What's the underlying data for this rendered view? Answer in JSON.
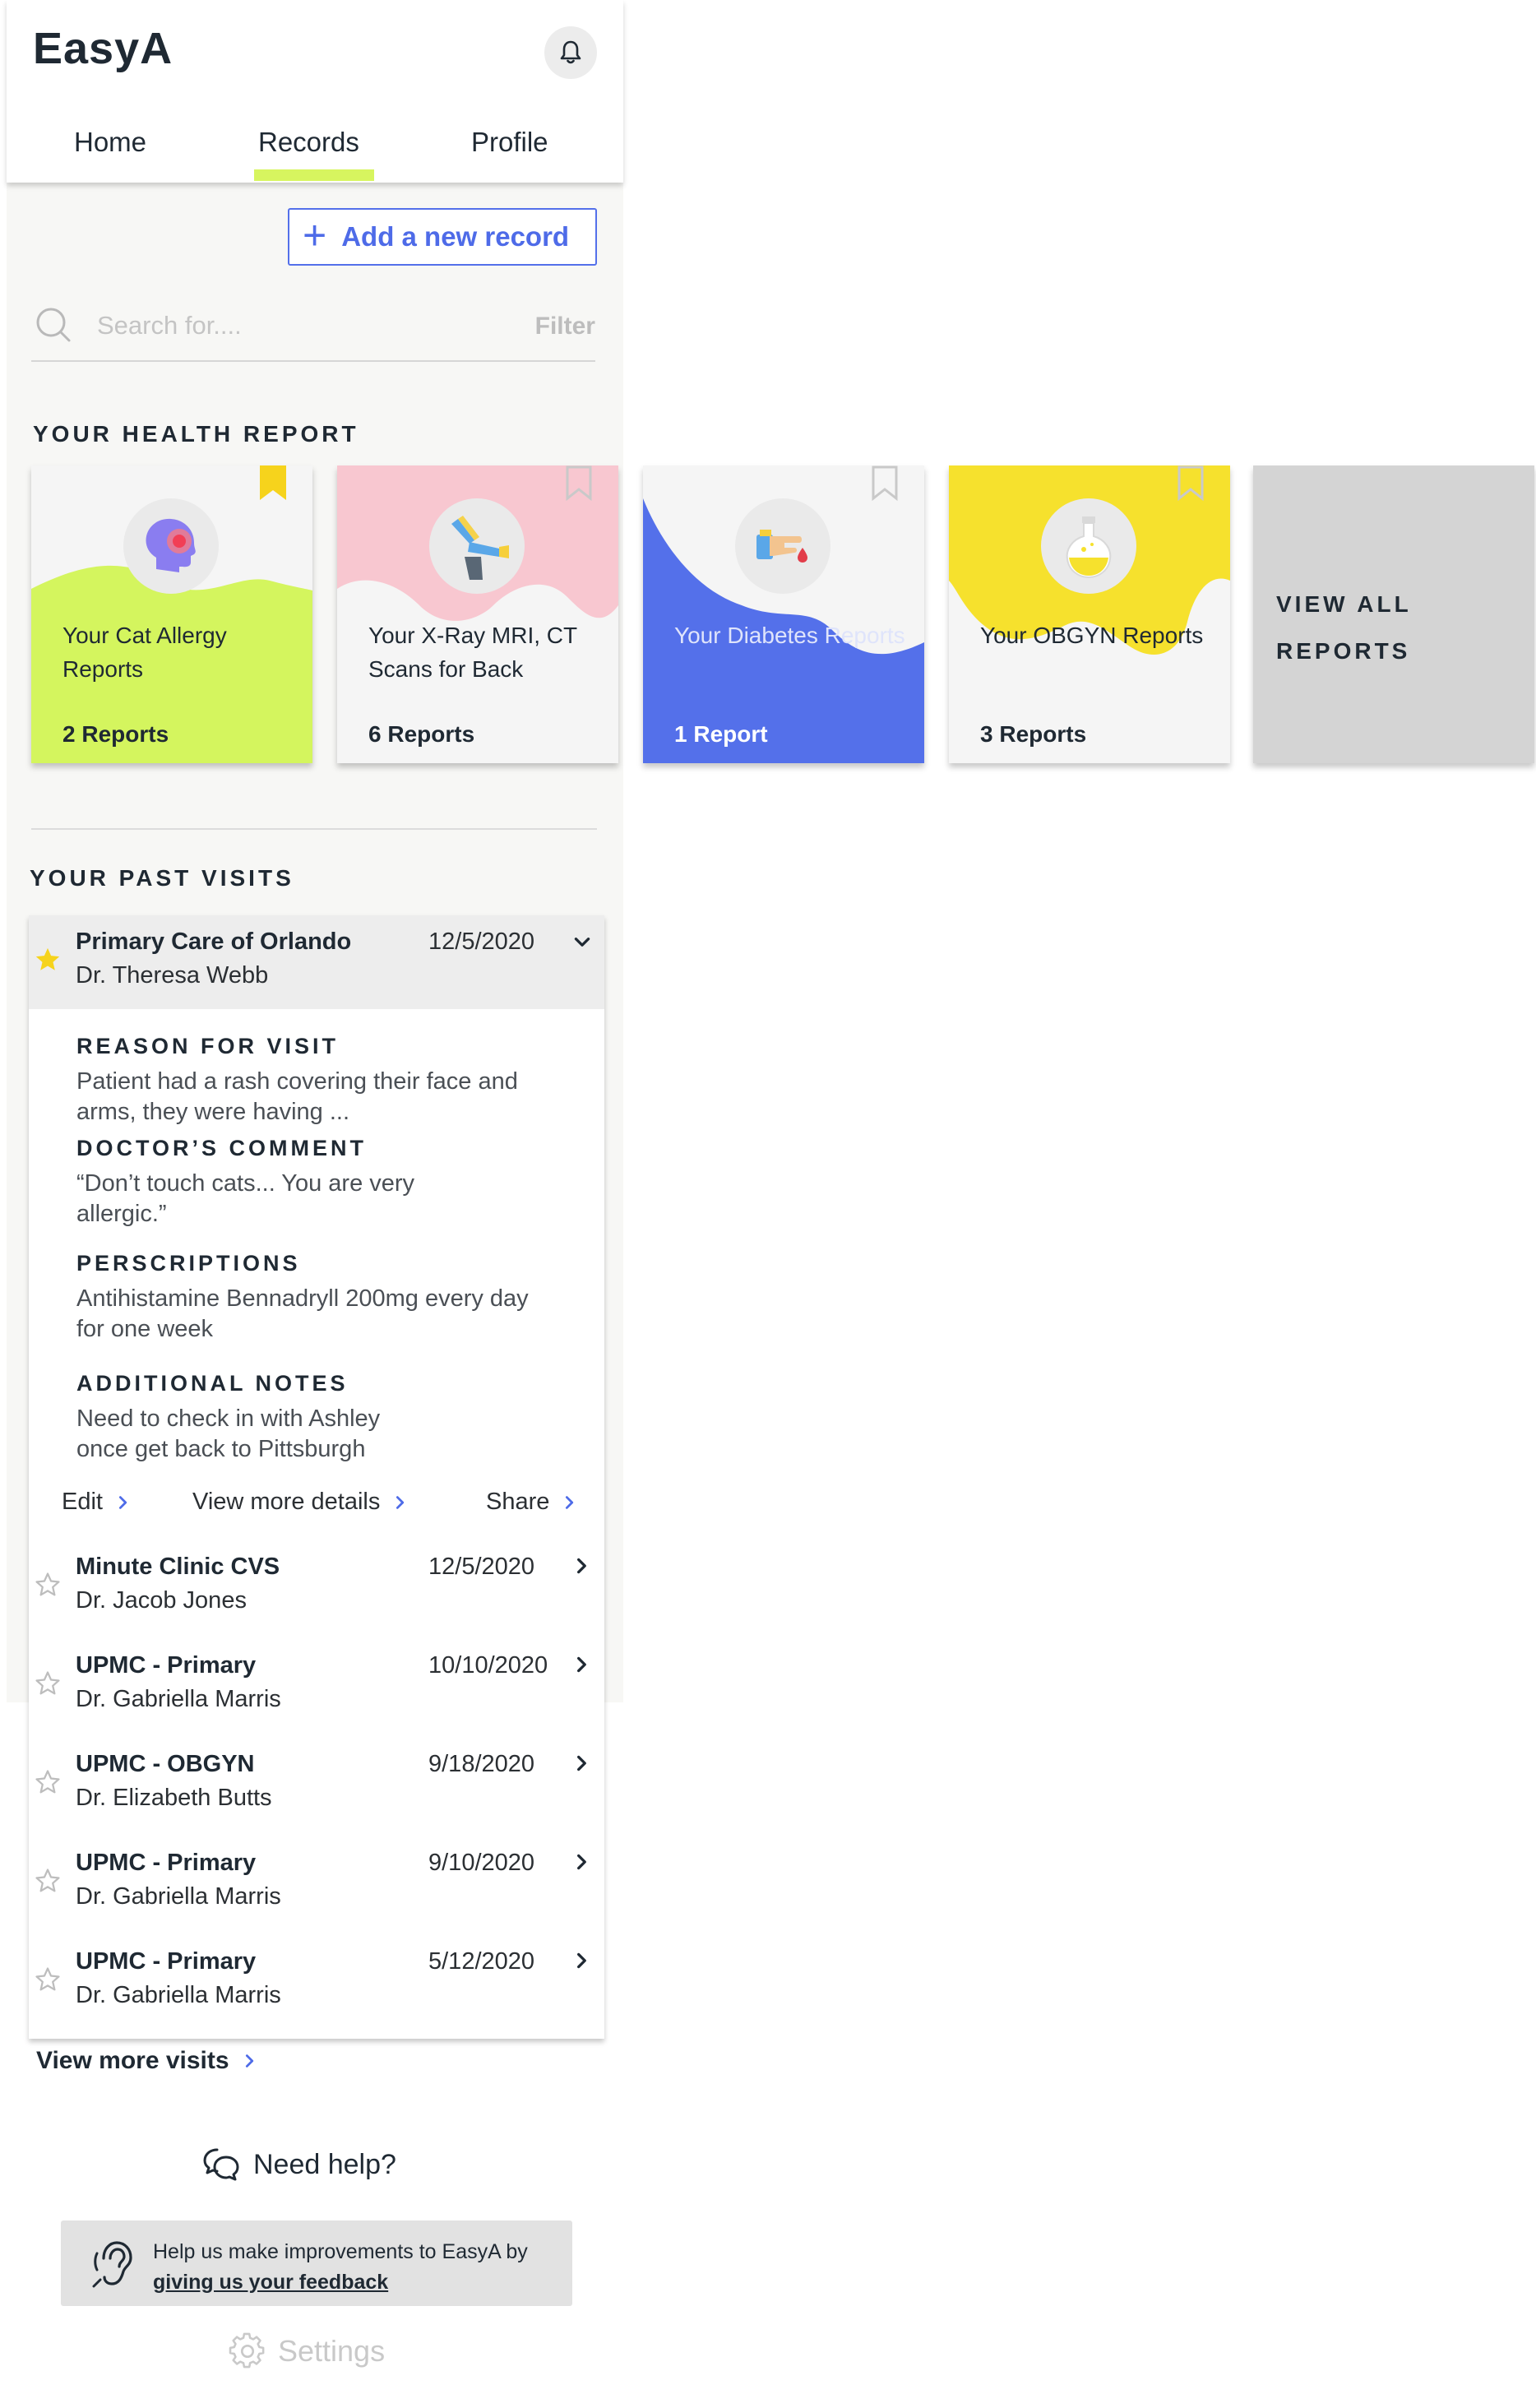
{
  "app": {
    "name": "EasyA"
  },
  "tabs": [
    {
      "label": "Home"
    },
    {
      "label": "Records",
      "active": true
    },
    {
      "label": "Profile"
    }
  ],
  "add_record": {
    "label": "Add a new record"
  },
  "search": {
    "placeholder": "Search for....",
    "filter_label": "Filter"
  },
  "health_report": {
    "title": "YOUR HEALTH REPORT",
    "cards": [
      {
        "title": "Your Cat Allergy Reports",
        "count": "2 Reports",
        "color": "#d4f55e",
        "bookmarked": true,
        "icon": "allergy-head-icon"
      },
      {
        "title": "Your X-Ray MRI, CT Scans for Back",
        "count": "6 Reports",
        "color": "#f8c7d0",
        "bookmarked": false,
        "icon": "dental-xray-icon"
      },
      {
        "title": "Your Diabetes Reports",
        "count": "1 Report",
        "color": "#5470ea",
        "bookmarked": false,
        "icon": "blood-test-finger-icon"
      },
      {
        "title": "Your OBGYN Reports",
        "count": "3 Reports",
        "color": "#f6e12d",
        "bookmarked": false,
        "icon": "lab-flask-icon"
      }
    ],
    "view_all": "VIEW ALL REPORTS"
  },
  "past_visits": {
    "title": "YOUR PAST VISITS",
    "expanded": {
      "place": "Primary Care of Orlando",
      "doctor": "Dr. Theresa Webb",
      "date": "12/5/2020",
      "starred": true,
      "reason_label": "REASON FOR VISIT",
      "reason_text": "Patient had a rash covering their face and arms, they were having ...",
      "comment_label": "DOCTOR’S COMMENT",
      "comment_text": "“Don’t touch cats... You are very allergic.”",
      "prescriptions_label": "PERSCRIPTIONS",
      "prescriptions_text": "Antihistamine Bennadryll 200mg every day for one week",
      "notes_label": "ADDITIONAL NOTES",
      "notes_text": "Need to check in with Ashley once get back to Pittsburgh",
      "actions": {
        "edit": "Edit",
        "details": "View more details",
        "share": "Share"
      }
    },
    "visits": [
      {
        "place": "Minute Clinic CVS",
        "doctor": "Dr. Jacob Jones",
        "date": "12/5/2020"
      },
      {
        "place": "UPMC - Primary",
        "doctor": "Dr. Gabriella Marris",
        "date": "10/10/2020"
      },
      {
        "place": "UPMC - OBGYN",
        "doctor": "Dr. Elizabeth Butts",
        "date": "9/18/2020"
      },
      {
        "place": "UPMC - Primary",
        "doctor": "Dr. Gabriella Marris",
        "date": "9/10/2020"
      },
      {
        "place": "UPMC - Primary",
        "doctor": "Dr. Gabriella Marris",
        "date": "5/12/2020"
      }
    ],
    "view_more": "View more visits"
  },
  "help": {
    "label": "Need help?"
  },
  "feedback": {
    "text_before": "Help us make improvements to EasyA by ",
    "link": "giving us your feedback"
  },
  "settings": {
    "label": "Settings"
  },
  "colors": {
    "accent": "#5470ea",
    "tab_underline": "#d7f55f",
    "star": "#f6d31c"
  }
}
